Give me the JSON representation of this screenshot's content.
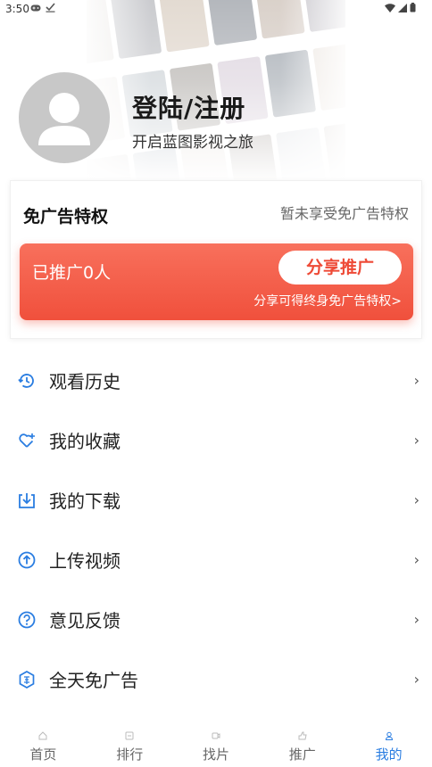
{
  "status_bar": {
    "time": "3:50"
  },
  "profile": {
    "title": "登陆/注册",
    "subtitle": "开启蓝图影视之旅"
  },
  "privilege": {
    "title": "免广告特权",
    "status": "暂未享受免广告特权",
    "promo_count": "已推广0人",
    "share_button": "分享推广",
    "hint": "分享可得终身免广告特权>"
  },
  "menu": [
    {
      "label": "观看历史",
      "icon": "history-icon"
    },
    {
      "label": "我的收藏",
      "icon": "favorite-heart-icon"
    },
    {
      "label": "我的下载",
      "icon": "download-icon"
    },
    {
      "label": "上传视频",
      "icon": "upload-icon"
    },
    {
      "label": "意见反馈",
      "icon": "help-question-icon"
    },
    {
      "label": "全天免广告",
      "icon": "ad-free-badge-icon"
    }
  ],
  "menu_arrow": "›",
  "bottom_nav": [
    {
      "label": "首页",
      "icon": "home-icon"
    },
    {
      "label": "排行",
      "icon": "rank-icon"
    },
    {
      "label": "找片",
      "icon": "video-search-icon"
    },
    {
      "label": "推广",
      "icon": "promote-icon"
    },
    {
      "label": "我的",
      "icon": "user-icon",
      "active": true
    }
  ],
  "colors": {
    "accent_blue": "#2a7de1",
    "promo_red": "#f0503c",
    "avatar_gray": "#c8c8c8"
  }
}
